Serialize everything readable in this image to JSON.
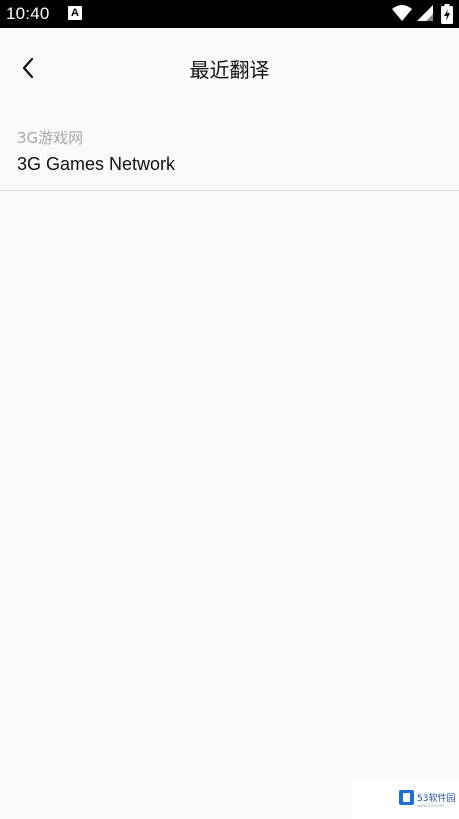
{
  "status_bar": {
    "time": "10:40",
    "notification_icon_letter": "A",
    "icons": [
      "wifi-icon",
      "signal-icon",
      "battery-icon"
    ]
  },
  "app_bar": {
    "back_icon": "chevron-left-icon",
    "title": "最近翻译"
  },
  "history": {
    "items": [
      {
        "source": "3G游戏网",
        "translation": "3G Games Network"
      }
    ]
  },
  "watermark": {
    "text": "53软件园",
    "subtext": "www.53r.com"
  },
  "colors": {
    "background": "#fafafa",
    "status_bar": "#000000",
    "source_text": "#a8a8a8",
    "primary_text": "#111111",
    "divider": "#dcdcdc",
    "watermark_accent": "#1f6fd1"
  }
}
